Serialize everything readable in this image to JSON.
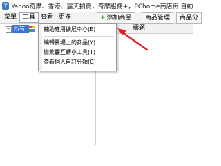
{
  "window": {
    "title": "Yahoo奇摩、香港、露天拍賣，奇摩服務+，PChome商店街 自動上傳"
  },
  "menubar": {
    "items": [
      "菜單",
      "工具",
      "查看",
      "更多"
    ]
  },
  "toolbar": {
    "add_product": "添加商品",
    "product_manage": "商品管理",
    "product_category": "商品分"
  },
  "tree": {
    "root_label": "所有"
  },
  "table": {
    "title_header": "標題"
  },
  "dropdown": {
    "items": [
      "輔助應用擴展中心(E)",
      "編輯賣場上的商品(Y)",
      "簡繁體互轉小工具(T)",
      "查看個人自訂分類(C)"
    ]
  },
  "annotation": {
    "arrow_color": "#e02020"
  }
}
